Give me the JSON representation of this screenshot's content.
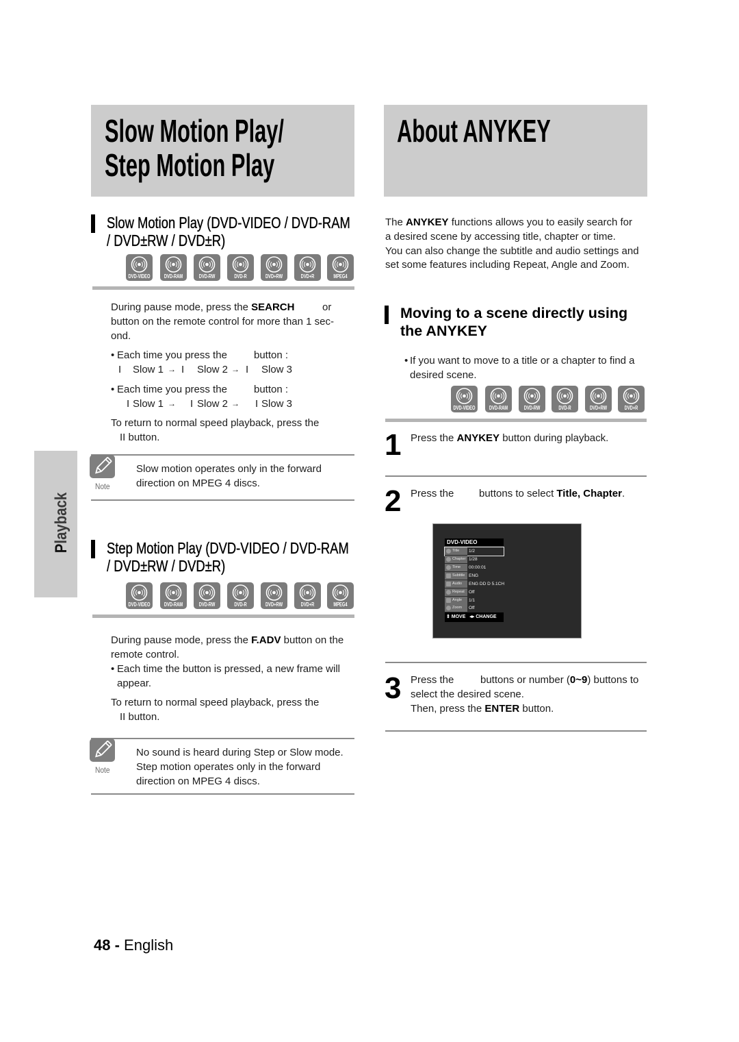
{
  "left_page": {
    "title": [
      "Slow Motion Play/",
      "Step Motion Play"
    ],
    "slow_motion": {
      "heading": [
        "Slow Motion Play (DVD-VIDEO / DVD-RAM",
        "/ DVD±RW / DVD±R)"
      ],
      "discs": [
        "DVD-VIDEO",
        "DVD-RAM",
        "DVD-RW",
        "DVD-R",
        "DVD+RW",
        "DVD+R",
        "MPEG4"
      ],
      "instruction": {
        "line1_before": "During pause mode, press the ",
        "line1_bold": "SEARCH",
        "line1_after": "or",
        "line2": "button on the remote control for more than 1 sec-",
        "line3": "ond."
      },
      "bullets": [
        {
          "bullet": "•",
          "text": "Each time you press the",
          "suffix": "button :",
          "arrow": "→",
          "sequence": [
            {
              "marker": "I",
              "label": "Slow 1"
            },
            {
              "marker": "I",
              "label": "Slow 2"
            },
            {
              "marker": "I",
              "label": "Slow 3"
            }
          ]
        },
        {
          "bullet": "•",
          "text": "Each time you press the",
          "suffix": "button :",
          "arrow": "→",
          "sequence": [
            {
              "marker": "I",
              "label": "Slow 1"
            },
            {
              "marker": "I",
              "label": "Slow 2"
            },
            {
              "marker": "I",
              "label": "Slow 3"
            }
          ]
        }
      ],
      "return": {
        "line1": "To return to normal speed playback, press the",
        "line2": "II button."
      },
      "note": {
        "label": "Note",
        "lines": [
          "Slow motion operates only in the forward",
          "direction on MPEG 4 discs."
        ]
      }
    },
    "step_motion": {
      "heading": [
        "Step Motion Play (DVD-VIDEO / DVD-RAM",
        "/ DVD±RW / DVD±R)"
      ],
      "discs": [
        "DVD-VIDEO",
        "DVD-RAM",
        "DVD-RW",
        "DVD-R",
        "DVD+RW",
        "DVD+R",
        "MPEG4"
      ],
      "instruction": {
        "line1_before": "During pause mode, press the ",
        "line1_bold": "F.ADV",
        "line1_after": " button on the",
        "line2": "remote control."
      },
      "bullet": {
        "bullet": "•",
        "line1": "Each time the button is pressed, a new frame will",
        "line2": "appear."
      },
      "return": {
        "line1": "To return to normal speed playback, press the",
        "line2": "II button."
      },
      "note": {
        "label": "Note",
        "lines": [
          "No sound is heard during Step or Slow mode.",
          "Step motion operates only in the forward",
          "direction on MPEG 4 discs."
        ]
      }
    }
  },
  "side_tab": {
    "first": "P",
    "rest": "layback"
  },
  "right_page": {
    "title": "About ANYKEY",
    "intro": {
      "line1_before": "The ",
      "line1_bold": "ANYKEY",
      "line1_after": " functions allows you to easily search for",
      "line2": "a desired scene by accessing title, chapter or time.",
      "line3": "You can also change the subtitle and audio settings and",
      "line4": "set some features including Repeat, Angle and Zoom."
    },
    "section": {
      "heading": [
        "Moving to a scene directly using",
        "the ANYKEY"
      ],
      "bullet": {
        "bullet": "•",
        "line1": "If you want to move to a title or a chapter to find a",
        "line2": "desired scene."
      },
      "discs": [
        "DVD-VIDEO",
        "DVD-RAM",
        "DVD-RW",
        "DVD-R",
        "DVD+RW",
        "DVD+R"
      ]
    },
    "steps": [
      {
        "number": "1",
        "before": "Press the ",
        "bold": "ANYKEY",
        "after": " button during playback."
      },
      {
        "number": "2",
        "lead": "Press the",
        "before": "buttons to select ",
        "bold": "Title, Chapter",
        "after": "."
      },
      {
        "number": "3",
        "lead": "Press the",
        "before": "buttons or number (",
        "bold": "0~9",
        "after": ") buttons to",
        "line2": "select the desired scene.",
        "line3_before": "Then, press the ",
        "line3_bold": "ENTER",
        "line3_after": " button."
      }
    ],
    "osd": {
      "header": "DVD-VIDEO",
      "rows": [
        {
          "label": "Title",
          "value": "1/2",
          "selected": true
        },
        {
          "label": "Chapter",
          "value": "1/28"
        },
        {
          "label": "Time",
          "value": "00:00:01"
        },
        {
          "label": "Subtitle",
          "value": "ENG"
        },
        {
          "label": "Audio",
          "value": "ENG DD D 5.1CH"
        },
        {
          "label": "Repeat",
          "value": "Off"
        },
        {
          "label": "Angle",
          "value": "1/1"
        },
        {
          "label": "Zoom",
          "value": "Off"
        }
      ],
      "footer": {
        "move_icon": "⇕",
        "move": "MOVE",
        "change_icon": "◂▸",
        "change": "CHANGE"
      }
    }
  },
  "footer": {
    "page_number": "48 -",
    "language": "English"
  },
  "colors": {
    "panel_gray": "#cccccc",
    "divider_gray": "#b4b4b4",
    "rule_gray": "#8a8a8a",
    "badge_gray": "#7b7b7b",
    "text": "#1c1c1c"
  }
}
